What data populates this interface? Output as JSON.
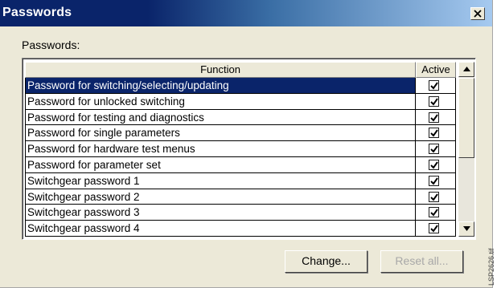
{
  "window": {
    "title": "Passwords",
    "close_glyph": "✕"
  },
  "section_label": "Passwords:",
  "table": {
    "columns": [
      "Function",
      "Active"
    ],
    "selected_index": 0,
    "rows": [
      {
        "function": "Password for switching/selecting/updating",
        "active": true
      },
      {
        "function": "Password for unlocked switching",
        "active": true
      },
      {
        "function": "Password for testing and diagnostics",
        "active": true
      },
      {
        "function": "Password for single parameters",
        "active": true
      },
      {
        "function": "Password for hardware test menus",
        "active": true
      },
      {
        "function": "Password for parameter set",
        "active": true
      },
      {
        "function": "Switchgear password  1",
        "active": true
      },
      {
        "function": "Switchgear password  2",
        "active": true
      },
      {
        "function": "Switchgear password  3",
        "active": true
      },
      {
        "function": "Switchgear password  4",
        "active": true
      }
    ]
  },
  "buttons": {
    "change": "Change...",
    "reset_all": "Reset all..."
  },
  "side_label": "LSP2626.tif",
  "colors": {
    "selection": "#0a246a",
    "dialog_bg": "#ece9d8"
  }
}
